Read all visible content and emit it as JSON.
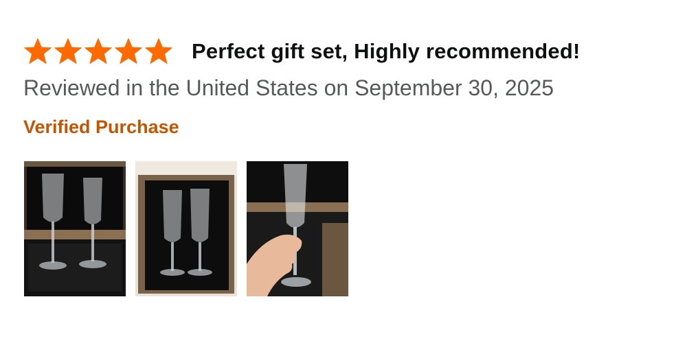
{
  "review": {
    "rating": 5,
    "rating_max": 5,
    "star_icon": "star-filled-icon",
    "title": "Perfect gift set, Highly recommended!",
    "date_line": "Reviewed in the United States on September 30, 2025",
    "verified_label": "Verified Purchase",
    "colors": {
      "star": "#ff6a00",
      "title": "#0f1111",
      "date": "#565959",
      "verified": "#c45500"
    },
    "images": [
      {
        "subject": "two champagne flutes in a wooden gift box"
      },
      {
        "subject": "two engraved champagne flutes standing in wooden box"
      },
      {
        "subject": "hand holding an engraved champagne flute above open box"
      }
    ]
  }
}
